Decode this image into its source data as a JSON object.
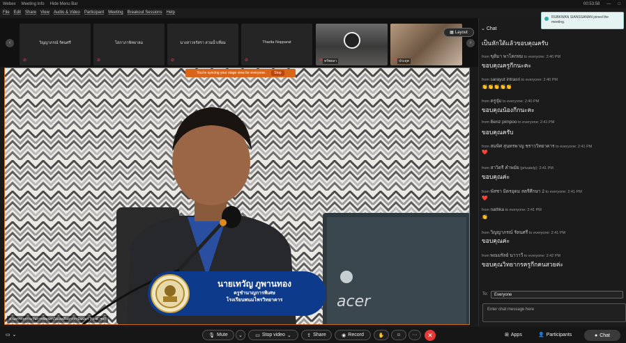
{
  "titlebar": {
    "app": "Webex",
    "meeting_info": "Meeting Info",
    "hide_menu": "Hide Menu Bar",
    "time": "00:53:58"
  },
  "menu": [
    "File",
    "Edit",
    "Share",
    "View",
    "Audio & Video",
    "Participant",
    "Meeting",
    "Breakout Sessions",
    "Help"
  ],
  "strip": {
    "tiles": [
      {
        "name": "วิญญาภรณ์ รัตนศรี"
      },
      {
        "name": "โสภาภาพิทยาลม"
      },
      {
        "name": "นางสาวจรัสรา สวนน้ำเที่ยม"
      },
      {
        "name": "Tharita Nopparat"
      },
      {
        "name": "ทรัพยลา"
      },
      {
        "name": "ประดุค"
      }
    ],
    "layout_label": "Layout"
  },
  "stage": {
    "sync_text": "You're syncing your stage view for everyone.",
    "stop_label": "Stop",
    "label": "ส.นอการบรรวะรับการพัฒนารไอเลลสี่ เยาวรานันปมา (Host, me)",
    "lower_third": {
      "name": "นายเทวัญ ภูพานทอง",
      "title": "ครูชำนาญการพิเศษ",
      "school": "โรงเรียนพนมไพรวิทยาคาร"
    }
  },
  "chat": {
    "header": "Chat",
    "first_line": "เป็นหักใต้แล้วขอบคุณครับ",
    "messages": [
      {
        "from": "ขุติมา พาโคกทม",
        "to": "to everyone:",
        "time": "2:40 PM",
        "text": "ขอบคุณครูกีกนะคะ"
      },
      {
        "from": "sarayut intrasri",
        "to": "to everyone:",
        "time": "2:40 PM",
        "text": "👏👏👏👏👏"
      },
      {
        "from": "ครูจุ๋ม",
        "to": "to everyone:",
        "time": "2:40 PM",
        "text": "ขอบคุณน้องกีกนะคะ"
      },
      {
        "from": "Benz pimpoo",
        "to": "to everyone:",
        "time": "2:41 PM",
        "text": "ขอบคุณครับ"
      },
      {
        "from": "สมพิศ สุนทรพาญ ชราววิทยาคาร",
        "to": "to everyone:",
        "time": "2:41 PM",
        "text": "❤️"
      },
      {
        "from": "สาวิตรี คำพมัย",
        "to": "(privately):",
        "time": "2:41 PM",
        "text": "ขอบคุณค่ะ"
      },
      {
        "from": "พัสชา มิตรอุดม สตรีศึกษา 2",
        "to": "to everyone:",
        "time": "2:41 PM",
        "text": "❤️"
      },
      {
        "from": "nathka",
        "to": "to everyone:",
        "time": "2:41 PM",
        "text": "👏"
      },
      {
        "from": "วิญญาภรณ์ รัตนศรี",
        "to": "to everyone:",
        "time": "2:41 PM",
        "text": "ขอบคุณค่ะ"
      },
      {
        "from": "พณมรัลย์ นาวาวี",
        "to": "to everyone:",
        "time": "2:42 PM",
        "text": "ขอบคุณวิทยากรครูกีกคนสวยค่ะ"
      }
    ],
    "to_label": "To:",
    "to_value": "Everyone",
    "input_placeholder": "Enter chat message here"
  },
  "toast": {
    "text": "RUBKWAN SIANSSANAN joined the meeting."
  },
  "toolbar": {
    "mute": "Mute",
    "stop_video": "Stop video",
    "share": "Share",
    "record": "Record",
    "apps": "Apps",
    "participants": "Participants",
    "chat": "Chat"
  }
}
